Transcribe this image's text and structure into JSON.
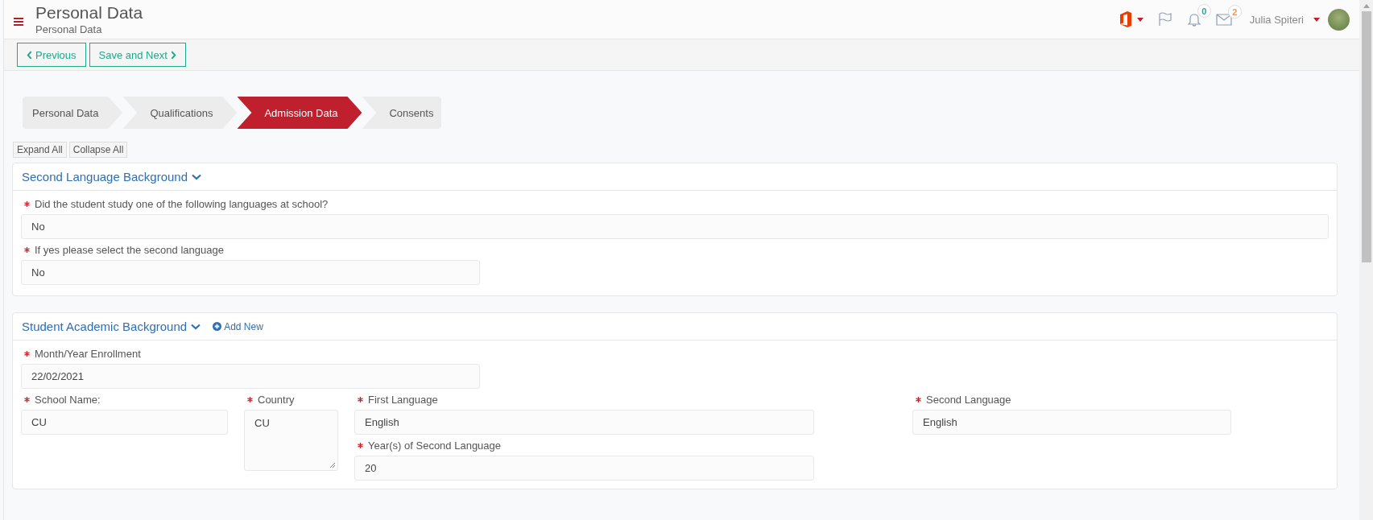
{
  "header": {
    "title": "Personal Data",
    "subtitle": "Personal Data",
    "notifications": [
      {
        "kind": "bell",
        "count": "0",
        "color": "#26a69a"
      },
      {
        "kind": "mail",
        "count": "2",
        "color": "#f0965a"
      }
    ],
    "user_name": "Julia Spiteri"
  },
  "toolbar": [
    {
      "kind": "previous",
      "label": "Previous"
    },
    {
      "kind": "next",
      "label": "Save and Next"
    }
  ],
  "steps": [
    {
      "label": "Personal Data",
      "selected": false
    },
    {
      "label": "Qualifications",
      "selected": false
    },
    {
      "label": "Admission Data",
      "selected": true
    },
    {
      "label": "Consents",
      "selected": false
    }
  ],
  "section_controls": [
    "Expand All",
    "Collapse All"
  ],
  "sections": [
    {
      "title": "Second Language Background",
      "expanded": true,
      "fields": [
        {
          "label": "Did the student study one of the following languages at school?",
          "value": "No",
          "required": true,
          "kind": "select"
        },
        {
          "label": "If yes please select the second language",
          "value": "No",
          "required": true,
          "kind": "select"
        }
      ]
    },
    {
      "title": "Student Academic Background",
      "expanded": true,
      "add_new": "Add New",
      "fields": [
        {
          "label": "Month/Year Enrollment",
          "value": "22/02/2021",
          "required": true,
          "kind": "text"
        },
        {
          "label": "School Name:",
          "value": "CU",
          "required": true,
          "kind": "text"
        },
        {
          "label": "Country",
          "value": "CU",
          "required": true,
          "kind": "textarea"
        },
        {
          "label": "First Language",
          "value": "English",
          "required": true,
          "kind": "select"
        },
        {
          "label": "Second Language",
          "value": "English",
          "required": true,
          "kind": "select"
        },
        {
          "label": "Year(s) of Second Language",
          "value": "20",
          "required": true,
          "kind": "text"
        }
      ]
    }
  ]
}
